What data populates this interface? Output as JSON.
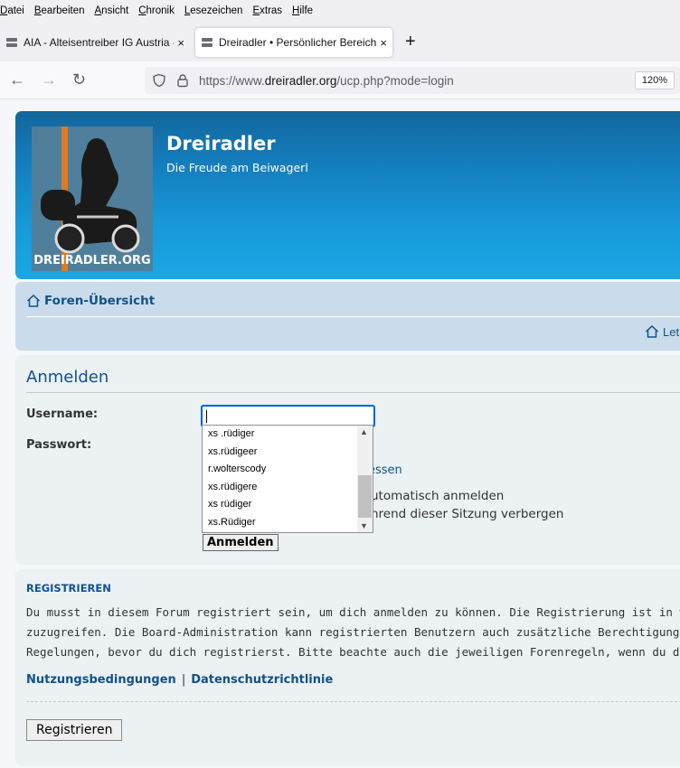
{
  "menubar": {
    "items": [
      "Datei",
      "Bearbeiten",
      "Ansicht",
      "Chronik",
      "Lesezeichen",
      "Extras",
      "Hilfe"
    ]
  },
  "tabs": {
    "tab1_title": "AIA - Alteisentreiber IG Austria -",
    "tab2_title": "Dreiradler • Persönlicher Bereich",
    "close_glyph": "×",
    "new_tab_glyph": "+"
  },
  "nav": {
    "back_glyph": "←",
    "forward_glyph": "→",
    "reload_glyph": "↻",
    "url_prefix": "https://www.",
    "url_domain": "dreiradler.org",
    "url_path": "/ucp.php?mode=login",
    "zoom": "120%"
  },
  "header": {
    "logo_text": "DREIRADLER.ORG",
    "site_title": "Dreiradler",
    "site_description": "Die Freude am Beiwagerl"
  },
  "breadcrumb": {
    "home": "Foren-Übersicht",
    "right_partial": "Let"
  },
  "login": {
    "title": "Anmelden",
    "username_label": "Username:",
    "password_label": "Passwort:",
    "forgot_partial": "essen",
    "remember_partial": "utomatisch anmelden",
    "hide_partial": "hrend dieser Sitzung verbergen",
    "submit_label": "Anmelden"
  },
  "autocomplete": {
    "items": [
      "xs .rüdiger",
      "xs.rüdigeer",
      "r.wolterscody",
      "xs.rüdigere",
      "xs rüdiger",
      "xs.Rüdiger"
    ],
    "up_glyph": "▲",
    "down_glyph": "▼"
  },
  "register": {
    "title": "REGISTRIEREN",
    "line1": "Du musst in diesem Forum registriert sein, um dich anmelden zu können. Die Registrierung ist in wenigen Augenbl",
    "line2": "zuzugreifen. Die Board-Administration kann registrierten Benutzern auch zusätzliche Berechtigungen zuweisen. B",
    "line3": "Regelungen, bevor du dich registrierst. Bitte beachte auch die jeweiligen Forenregeln, wenn du dich in diesem Bo",
    "terms_link": "Nutzungsbedingungen",
    "separator": "|",
    "privacy_link": "Datenschutzrichtlinie",
    "button_label": "Registrieren"
  },
  "colors": {
    "header_blue": "#1479b8",
    "link_blue": "#105289",
    "panel_bg": "#ecf1f3",
    "nav_panel_bg": "#cadceb",
    "focus_blue": "#0060df"
  }
}
